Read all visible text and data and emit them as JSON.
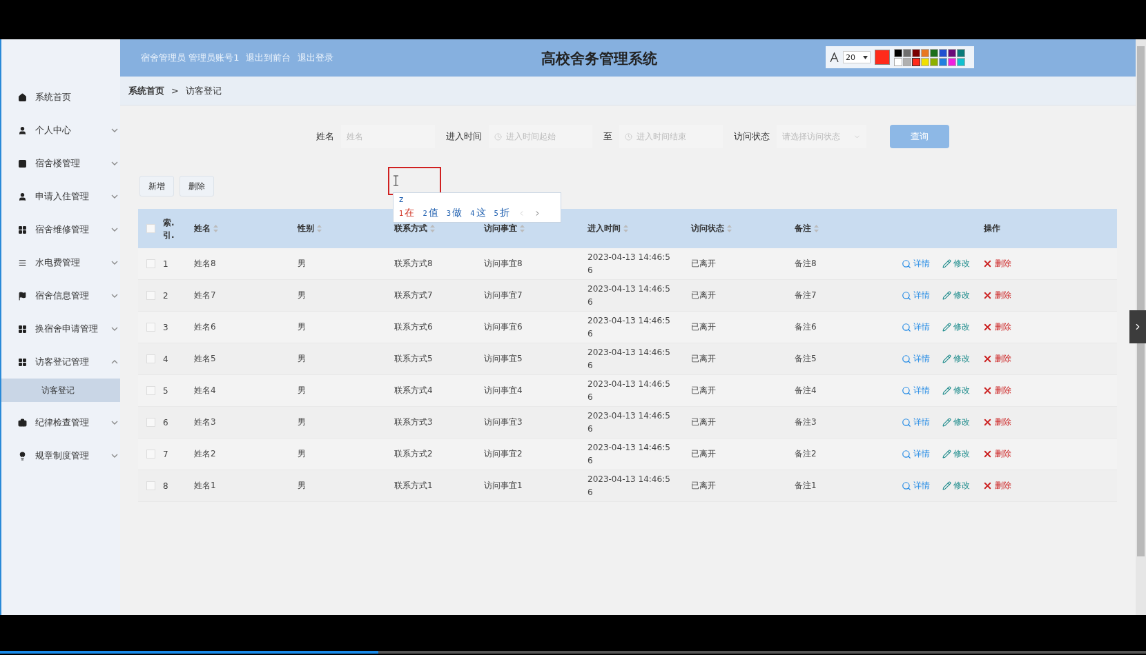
{
  "header": {
    "user_info": "宿舍管理员 管理员账号1",
    "links": [
      "退出到前台",
      "退出登录"
    ],
    "title": "高校舍务管理系统"
  },
  "annotation_toolbar": {
    "font_size": "20",
    "palette": [
      {
        "color": "#000000"
      },
      {
        "color": "#6e6e6e"
      },
      {
        "color": "#7a0000"
      },
      {
        "color": "#e87820"
      },
      {
        "color": "#1c6e1c"
      },
      {
        "color": "#2050d0"
      },
      {
        "color": "#6a0a7a"
      },
      {
        "color": "#0a7a7a"
      },
      {
        "color": "#ffffff"
      },
      {
        "color": "#b0b0b0"
      },
      {
        "color": "#ff2a1a",
        "selected": true
      },
      {
        "color": "#f0e000"
      },
      {
        "color": "#8cb000"
      },
      {
        "color": "#2080e0"
      },
      {
        "color": "#f020e0"
      },
      {
        "color": "#10c0d0"
      }
    ]
  },
  "ime_popup": {
    "input": "z",
    "candidates": [
      {
        "index": "1",
        "text": "在",
        "selected": true
      },
      {
        "index": "2",
        "text": "值",
        "selected": false
      },
      {
        "index": "3",
        "text": "做",
        "selected": false
      },
      {
        "index": "4",
        "text": "这",
        "selected": false
      },
      {
        "index": "5",
        "text": "折",
        "selected": false
      }
    ]
  },
  "sidebar": {
    "items": [
      {
        "label": "系统首页",
        "kind": "link"
      },
      {
        "label": "个人中心",
        "kind": "menu",
        "expanded": false
      },
      {
        "label": "宿舍楼管理",
        "kind": "menu",
        "expanded": false
      },
      {
        "label": "申请入住管理",
        "kind": "menu",
        "expanded": false
      },
      {
        "label": "宿舍维修管理",
        "kind": "menu",
        "expanded": false
      },
      {
        "label": "水电费管理",
        "kind": "menu",
        "expanded": false
      },
      {
        "label": "宿舍信息管理",
        "kind": "menu",
        "expanded": false
      },
      {
        "label": "换宿舍申请管理",
        "kind": "menu",
        "expanded": false
      },
      {
        "label": "访客登记管理",
        "kind": "menu",
        "expanded": true,
        "children": [
          {
            "label": "访客登记",
            "selected": true
          }
        ]
      },
      {
        "label": "纪律检查管理",
        "kind": "menu",
        "expanded": false
      },
      {
        "label": "规章制度管理",
        "kind": "menu",
        "expanded": false
      }
    ]
  },
  "breadcrumb": [
    "系统首页",
    "访客登记"
  ],
  "breadcrumb_separator": ">",
  "search": {
    "fields": [
      {
        "label": "姓名",
        "kind": "text",
        "placeholder": "姓名"
      },
      {
        "label": "进入时间",
        "kind": "date",
        "placeholder": "进入时间起始"
      },
      {
        "label": "至",
        "kind": "date",
        "placeholder": "进入时间结束"
      },
      {
        "label": "访问状态",
        "kind": "select",
        "placeholder": "请选择访问状态"
      }
    ],
    "button": "查询"
  },
  "actions": [
    "新增",
    "删除"
  ],
  "table": {
    "columns": [
      "索.引.",
      "姓名",
      "性别",
      "联系方式",
      "访问事宜",
      "进入时间",
      "访问状态",
      "备注",
      "操作"
    ],
    "all_checked": false,
    "rows": [
      {
        "checked": false,
        "index": "1",
        "name": "姓名8",
        "gender": "男",
        "contact": "联系方式8",
        "matter": "访问事宜8",
        "time": "2023-04-13 14:46:56",
        "status": "已离开",
        "remark": "备注8",
        "actions": [
          "详情",
          "修改",
          "删除"
        ]
      },
      {
        "checked": false,
        "index": "2",
        "name": "姓名7",
        "gender": "男",
        "contact": "联系方式7",
        "matter": "访问事宜7",
        "time": "2023-04-13 14:46:56",
        "status": "已离开",
        "remark": "备注7",
        "actions": [
          "详情",
          "修改",
          "删除"
        ]
      },
      {
        "checked": false,
        "index": "3",
        "name": "姓名6",
        "gender": "男",
        "contact": "联系方式6",
        "matter": "访问事宜6",
        "time": "2023-04-13 14:46:56",
        "status": "已离开",
        "remark": "备注6",
        "actions": [
          "详情",
          "修改",
          "删除"
        ]
      },
      {
        "checked": false,
        "index": "4",
        "name": "姓名5",
        "gender": "男",
        "contact": "联系方式5",
        "matter": "访问事宜5",
        "time": "2023-04-13 14:46:56",
        "status": "已离开",
        "remark": "备注5",
        "actions": [
          "详情",
          "修改",
          "删除"
        ]
      },
      {
        "checked": false,
        "index": "5",
        "name": "姓名4",
        "gender": "男",
        "contact": "联系方式4",
        "matter": "访问事宜4",
        "time": "2023-04-13 14:46:56",
        "status": "已离开",
        "remark": "备注4",
        "actions": [
          "详情",
          "修改",
          "删除"
        ]
      },
      {
        "checked": false,
        "index": "6",
        "name": "姓名3",
        "gender": "男",
        "contact": "联系方式3",
        "matter": "访问事宜3",
        "time": "2023-04-13 14:46:56",
        "status": "已离开",
        "remark": "备注3",
        "actions": [
          "详情",
          "修改",
          "删除"
        ]
      },
      {
        "checked": false,
        "index": "7",
        "name": "姓名2",
        "gender": "男",
        "contact": "联系方式2",
        "matter": "访问事宜2",
        "time": "2023-04-13 14:46:56",
        "status": "已离开",
        "remark": "备注2",
        "actions": [
          "详情",
          "修改",
          "删除"
        ]
      },
      {
        "checked": false,
        "index": "8",
        "name": "姓名1",
        "gender": "男",
        "contact": "联系方式1",
        "matter": "访问事宜1",
        "time": "2023-04-13 14:46:56",
        "status": "已离开",
        "remark": "备注1",
        "actions": [
          "详情",
          "修改",
          "删除"
        ]
      }
    ]
  },
  "video_progress": {
    "level": 0.33
  }
}
